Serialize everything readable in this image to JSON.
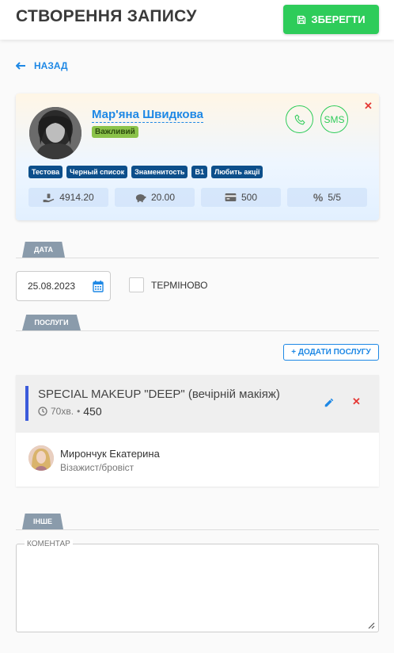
{
  "header": {
    "title": "СТВОРЕННЯ ЗАПИСУ",
    "save_label": "ЗБЕРЕГТИ"
  },
  "back": {
    "label": "НАЗАД"
  },
  "client": {
    "name": "Мар'яна Швидкова",
    "status": "Важливий",
    "sms_label": "SMS",
    "tags": [
      "Тестова",
      "Черный список",
      "Знаменитость",
      "B1",
      "Любить акції"
    ],
    "stats": [
      {
        "icon": "hand-money-icon",
        "value": "4914.20"
      },
      {
        "icon": "piggy-bank-icon",
        "value": "20.00"
      },
      {
        "icon": "credit-card-icon",
        "value": "500"
      },
      {
        "icon": "percent-icon",
        "value": "5/5"
      }
    ]
  },
  "date_section": {
    "tab": "ДАТА",
    "date_value": "25.08.2023",
    "urgent_label": "ТЕРМІНОВО"
  },
  "services_section": {
    "tab": "ПОСЛУГИ",
    "add_label": "+ ДОДАТИ ПОСЛУГУ",
    "service": {
      "title": "SPECIAL MAKEUP \"DEEP\" (вечірній макіяж)",
      "duration": "70хв.",
      "separator": "•",
      "price": "450",
      "master_name": "Мирончук Екатерина",
      "master_role": "Візажист/бровіст"
    }
  },
  "other_section": {
    "tab": "ІНШЕ",
    "comment_label": "КОМЕНТАР",
    "comment_value": ""
  },
  "colors": {
    "accent": "#1e88e5",
    "success": "#2ecc5a",
    "danger": "#e53935",
    "tag": "#0d4f8b",
    "section_tab": "#8a9bab"
  }
}
